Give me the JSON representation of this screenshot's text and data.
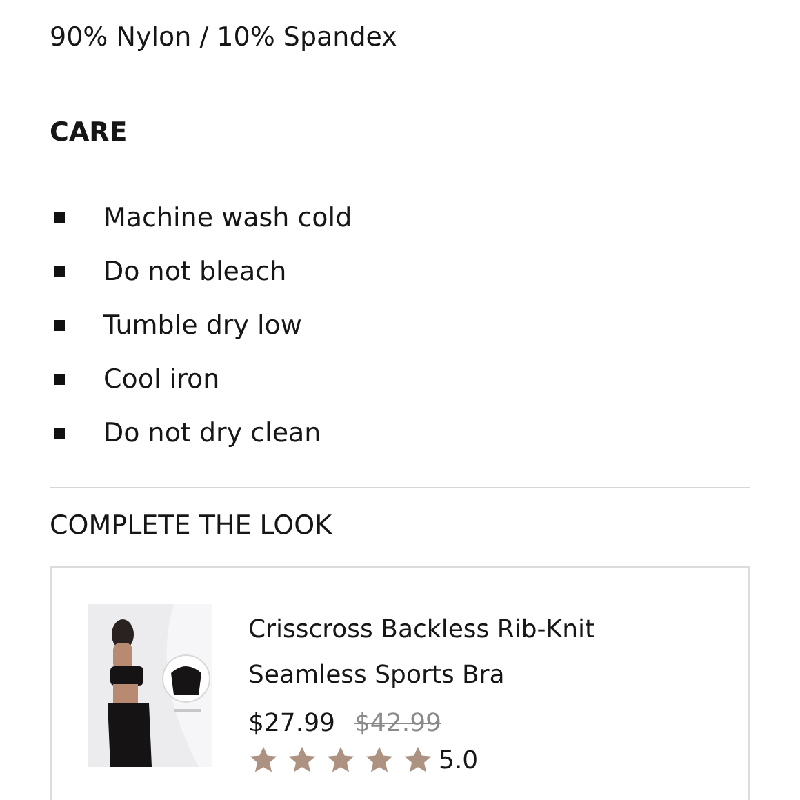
{
  "material": "90% Nylon / 10% Spandex",
  "care": {
    "heading": "CARE",
    "items": [
      "Machine wash cold",
      "Do not bleach",
      "Tumble dry low",
      "Cool iron",
      "Do not dry clean"
    ]
  },
  "complete_the_look": {
    "heading": "COMPLETE THE LOOK",
    "product": {
      "name": "Crisscross Backless Rib-Knit Seamless Sports Bra",
      "price": "$27.99",
      "original_price": "$42.99",
      "stars": 5,
      "rating": "5.0"
    }
  }
}
